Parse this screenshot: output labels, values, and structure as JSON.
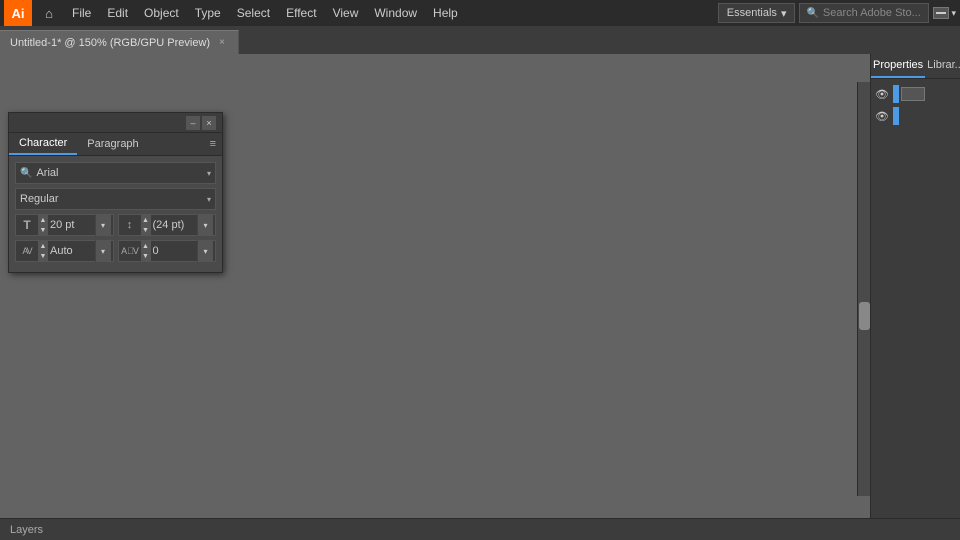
{
  "app": {
    "logo": "Ai",
    "title": "Adobe Illustrator"
  },
  "menubar": {
    "items": [
      "File",
      "Edit",
      "Object",
      "Type",
      "Select",
      "Effect",
      "View",
      "Window",
      "Help"
    ],
    "essentials": "Essentials",
    "search_placeholder": "Search Adobe Sto..."
  },
  "tab": {
    "title": "Untitled-1* @ 150% (RGB/GPU Preview)",
    "close": "×"
  },
  "character_panel": {
    "title": "",
    "tabs": [
      "Character",
      "Paragraph"
    ],
    "font_search": "Arial",
    "font_style": "Regular",
    "font_size": "20 pt",
    "leading": "(24 pt)",
    "kerning": "Auto",
    "tracking": "0",
    "minimize": "–",
    "close": "×",
    "menu": "≡"
  },
  "right_panel": {
    "tabs": [
      "Properties",
      "Librar..."
    ],
    "layers": [
      {
        "visible": true,
        "color": "#4d9be6",
        "name": ""
      },
      {
        "visible": true,
        "color": "#4d9be6",
        "name": ""
      }
    ]
  },
  "status_bar": {
    "text": "Layers"
  },
  "icons": {
    "home": "⌂",
    "search": "🔍",
    "eye": "👁",
    "dropdown_arrow": "▾",
    "up_arrow": "▲",
    "down_arrow": "▼",
    "font_size_icon": "T",
    "leading_icon": "↕",
    "kerning_icon": "AV",
    "tracking_icon": "AV",
    "hamburger": "≡"
  }
}
